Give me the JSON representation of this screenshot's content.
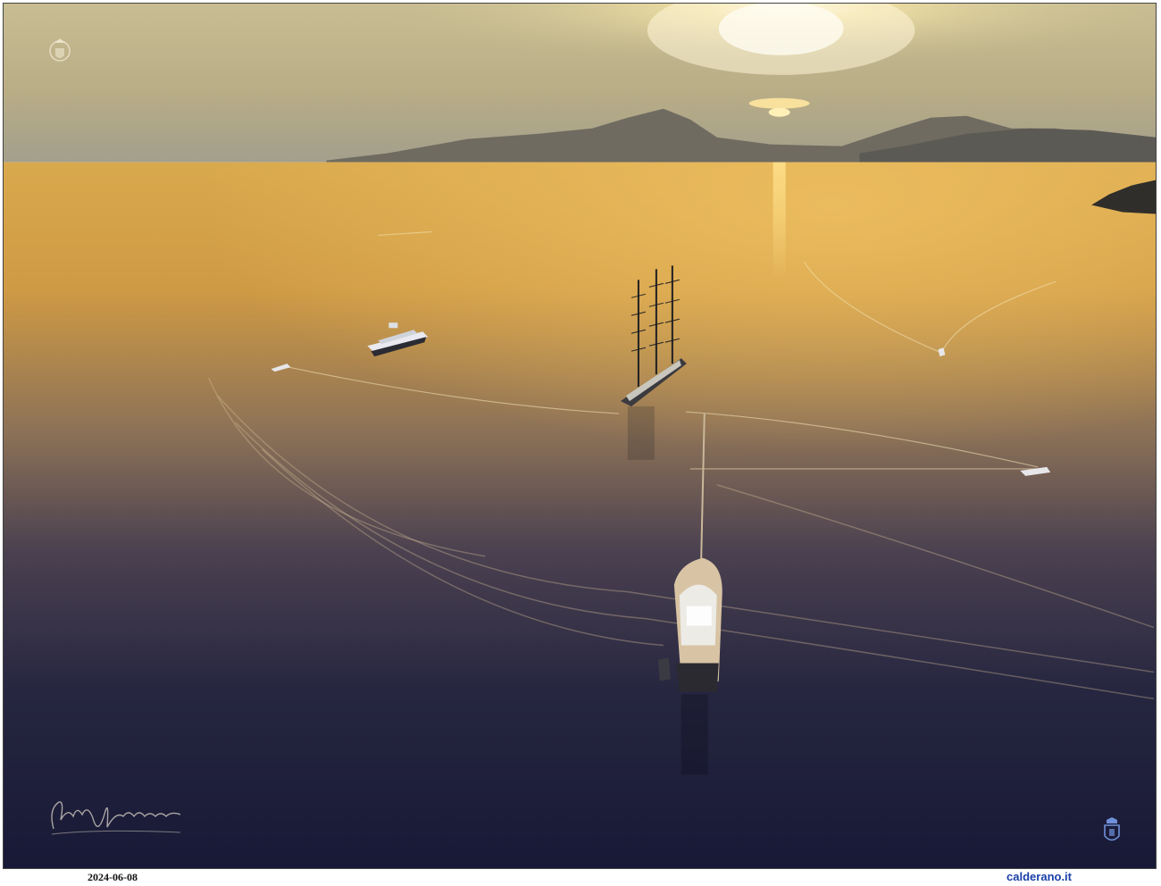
{
  "caption": {
    "date": "2024-06-08",
    "site": "calderano.it"
  },
  "marks": {
    "top_logo": "crest-logo-icon",
    "signature": "handwritten-signature",
    "bottom_logo": "crest-logo-icon"
  },
  "colors": {
    "sky_top": "#c9b98a",
    "sun": "#fff6cf",
    "horizon_glow": "#e8b44a",
    "mountains": "#6e6a5e",
    "sea_near": "#1c1c3a",
    "sea_mid": "#7d6a58",
    "site_link": "#1a3fa8"
  }
}
